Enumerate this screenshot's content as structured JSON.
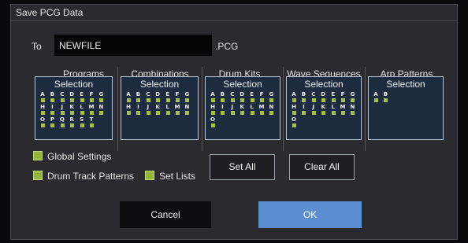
{
  "dialog": {
    "title": "Save PCG Data"
  },
  "to": {
    "label": "To",
    "filename": "NEWFILE",
    "extension": ".PCG"
  },
  "selection_label": "Selection",
  "columns": [
    {
      "id": "programs",
      "heading": "Programs",
      "rows": [
        [
          "A",
          "B",
          "C",
          "D",
          "E",
          "F",
          "G"
        ],
        [
          "H",
          "I",
          "J",
          "K",
          "L",
          "M",
          "N"
        ],
        [
          "O",
          "P",
          "Q",
          "R",
          "S",
          "T"
        ]
      ]
    },
    {
      "id": "combinations",
      "heading": "Combinations",
      "rows": [
        [
          "A",
          "B",
          "C",
          "D",
          "E",
          "F",
          "G"
        ],
        [
          "H",
          "I",
          "J",
          "K",
          "L",
          "M",
          "N"
        ]
      ]
    },
    {
      "id": "drum-kits",
      "heading": "Drum Kits",
      "rows": [
        [
          "A",
          "B",
          "C",
          "D",
          "E",
          "F",
          "G"
        ],
        [
          "H",
          "I",
          "J",
          "K",
          "L",
          "M",
          "N"
        ],
        [
          "O"
        ]
      ]
    },
    {
      "id": "wave-sequences",
      "heading": "Wave Sequences",
      "rows": [
        [
          "A",
          "B",
          "C",
          "D",
          "E",
          "F",
          "G"
        ],
        [
          "H",
          "I",
          "J",
          "K",
          "L",
          "M",
          "N"
        ],
        [
          "O"
        ]
      ]
    },
    {
      "id": "arp-patterns",
      "heading": "Arp Patterns",
      "rows": [
        [
          "A",
          "B"
        ]
      ]
    }
  ],
  "checkboxes": {
    "global_settings": "Global Settings",
    "drum_track_patterns": "Drum Track Patterns",
    "set_lists": "Set Lists"
  },
  "buttons": {
    "set_all": "Set All",
    "clear_all": "Clear All",
    "cancel": "Cancel",
    "ok": "OK"
  },
  "colors": {
    "accent": "#5b8ed0",
    "checked": "#a5c240",
    "panel": "#1c2b3e"
  }
}
